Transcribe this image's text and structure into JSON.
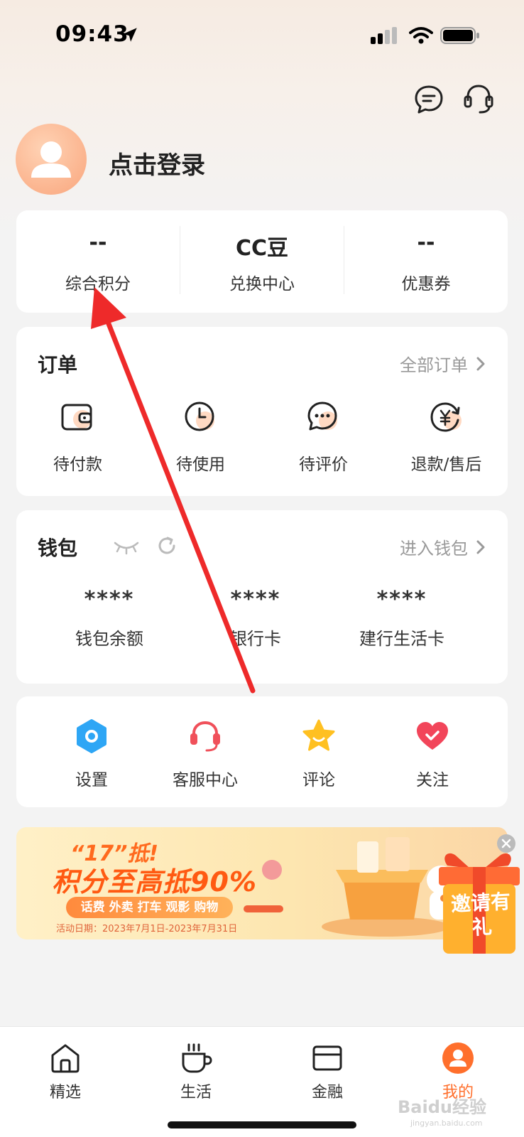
{
  "status_bar": {
    "time": "09:43"
  },
  "header": {
    "login_label": "点击登录"
  },
  "stats": [
    {
      "value": "--",
      "label": "综合积分"
    },
    {
      "value": "CC豆",
      "label": "兑换中心"
    },
    {
      "value": "--",
      "label": "优惠券"
    }
  ],
  "orders": {
    "title": "订单",
    "more_label": "全部订单",
    "items": [
      {
        "label": "待付款",
        "icon": "wallet-icon"
      },
      {
        "label": "待使用",
        "icon": "clock-icon"
      },
      {
        "label": "待评价",
        "icon": "chat-icon"
      },
      {
        "label": "退款/售后",
        "icon": "refund-icon"
      }
    ]
  },
  "wallet": {
    "title": "钱包",
    "more_label": "进入钱包",
    "items": [
      {
        "value": "****",
        "label": "钱包余额"
      },
      {
        "value": "****",
        "label": "银行卡"
      },
      {
        "value": "****",
        "label": "建行生活卡"
      }
    ]
  },
  "tools": [
    {
      "label": "设置",
      "icon": "settings-icon"
    },
    {
      "label": "客服中心",
      "icon": "headset-icon"
    },
    {
      "label": "评论",
      "icon": "star-icon"
    },
    {
      "label": "关注",
      "icon": "heart-icon"
    }
  ],
  "banner": {
    "headline1": "“17”抵!",
    "headline2": "积分至高抵90%",
    "tags": "话费 外卖 打车 观影 购物",
    "date": "活动日期：2023年7月1日-2023年7月31日",
    "invite": "邀请有礼"
  },
  "tabs": [
    {
      "label": "精选",
      "icon": "home-icon"
    },
    {
      "label": "生活",
      "icon": "cup-icon"
    },
    {
      "label": "金融",
      "icon": "card-icon"
    },
    {
      "label": "我的",
      "icon": "profile-icon"
    }
  ],
  "watermark": {
    "brand": "Baidu经验",
    "url": "jingyan.baidu.com"
  },
  "colors": {
    "accent": "#ff6f2c",
    "arrow": "#ee2a2a"
  }
}
